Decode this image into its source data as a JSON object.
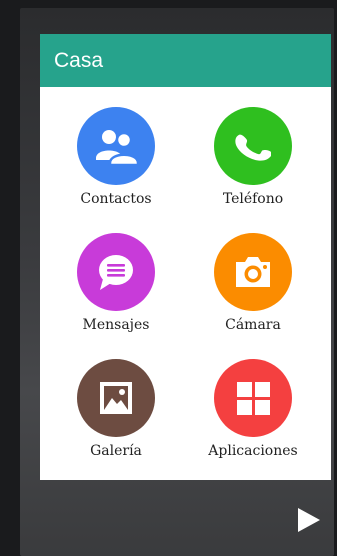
{
  "header": {
    "title": "Casa"
  },
  "apps": [
    {
      "label": "Contactos",
      "icon": "contacts-icon",
      "color": "#3d82f0"
    },
    {
      "label": "Teléfono",
      "icon": "phone-icon",
      "color": "#2fbf1f"
    },
    {
      "label": "Mensajes",
      "icon": "message-icon",
      "color": "#c83bd9"
    },
    {
      "label": "Cámara",
      "icon": "camera-icon",
      "color": "#fb8c00"
    },
    {
      "label": "Galería",
      "icon": "gallery-icon",
      "color": "#6d4c41"
    },
    {
      "label": "Aplicaciones",
      "icon": "apps-grid-icon",
      "color": "#f44040"
    }
  ],
  "nav": {
    "play_icon": "play-icon"
  },
  "colors": {
    "header": "#26a38c",
    "card": "#ffffff"
  }
}
